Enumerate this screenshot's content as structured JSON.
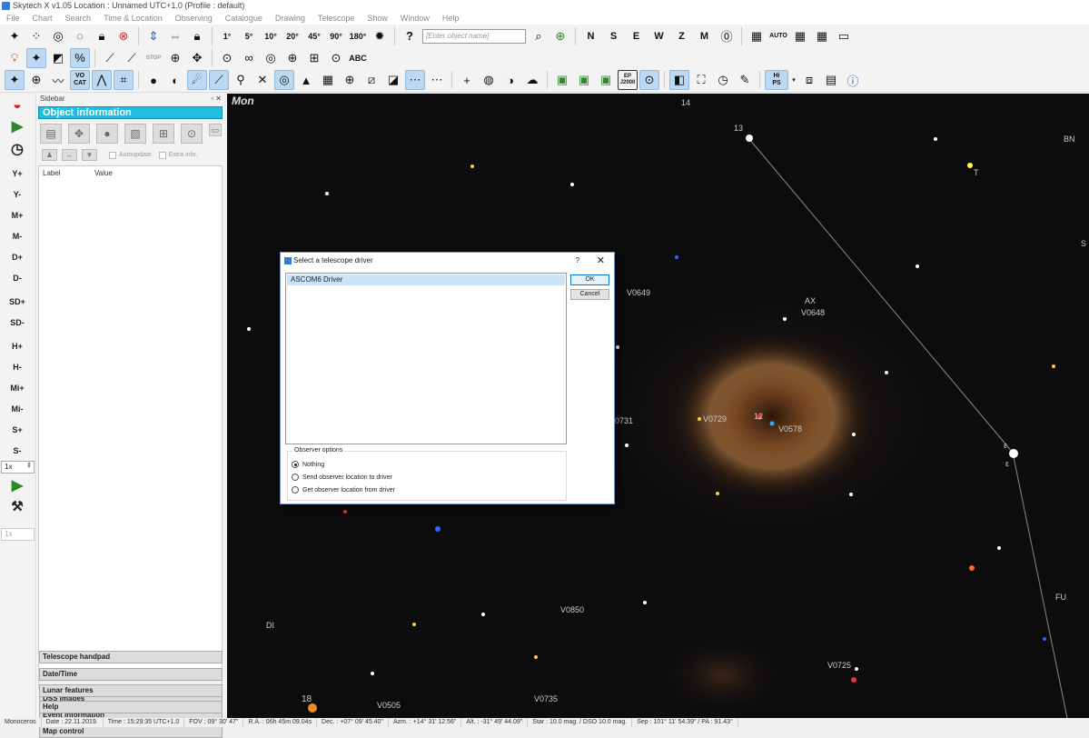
{
  "window": {
    "title": "Skytech X v1.05  Location : Unnamed  UTC+1.0 (Profile : default)"
  },
  "menu": [
    "File",
    "Chart",
    "Search",
    "Time & Location",
    "Observing",
    "Catalogue",
    "Drawing",
    "Telescope",
    "Show",
    "Window",
    "Help"
  ],
  "toolbar1": {
    "fov_labels": [
      "1°",
      "5°",
      "10°",
      "20°",
      "45°",
      "90°",
      "180°"
    ],
    "search_placeholder": "[Enter object name]",
    "help_label": "?",
    "directions": [
      "N",
      "S",
      "E",
      "W",
      "Z",
      "M"
    ],
    "auto_label": "AUTO"
  },
  "toolbar2": {
    "stop_label": "STOP",
    "abc_label": "ABC"
  },
  "toolbar3": {
    "vo_cat_label": "VO\nCAT",
    "hips_label": "Hi\nPS",
    "ep_label": "EP\nJ2000"
  },
  "leftbar": {
    "buttons": [
      "Y+",
      "Y-",
      "M+",
      "M-",
      "D+",
      "D-",
      "SD+",
      "SD-",
      "H+",
      "H-",
      "Mi+",
      "Mi-",
      "S+",
      "S-"
    ],
    "speed_value": "1x",
    "speed_value2": "1x"
  },
  "sidebar": {
    "title": "Sidebar",
    "panel_title": "Object information",
    "autoupdate_label": "Autoupdate",
    "extrainfo_label": "Extra info.",
    "columns": [
      "Label",
      "Value"
    ],
    "panels": [
      "DSS Images",
      "Event information",
      "Map control",
      "Telescope handpad",
      "Date/Time",
      "Lunar features",
      "Help"
    ]
  },
  "sky": {
    "constellation": "Mon",
    "labels": [
      {
        "text": "14"
      },
      {
        "text": "13"
      },
      {
        "text": "BN"
      },
      {
        "text": "T"
      },
      {
        "text": "S"
      },
      {
        "text": "V0649"
      },
      {
        "text": "AX"
      },
      {
        "text": "V0648"
      },
      {
        "text": "V0729"
      },
      {
        "text": "12"
      },
      {
        "text": "V0578"
      },
      {
        "text": "0731"
      },
      {
        "text": "ε"
      },
      {
        "text": "ε"
      },
      {
        "text": "FU"
      },
      {
        "text": "V0850"
      },
      {
        "text": "DI"
      },
      {
        "text": "V0725"
      },
      {
        "text": "18"
      },
      {
        "text": "V0505"
      },
      {
        "text": "V0735"
      }
    ]
  },
  "dialog": {
    "title": "Select a telescope driver",
    "help": "?",
    "close": "✕",
    "driver_item": "ASCOM6 Driver",
    "ok_label": "OK",
    "cancel_label": "Cancel",
    "observer_legend": "Observer options",
    "options": [
      "Nothing",
      "Send observer location to driver",
      "Get observer location from driver"
    ],
    "selected_option": "Nothing"
  },
  "status": {
    "constellation": "Monoceros",
    "date": "Date : 22.11.2019.",
    "time": "Time : 15:29:35 UTC+1.0",
    "fov": "FOV : 09° 30' 47\"",
    "ra": "R.A. : 06h 45m 09.04s",
    "dec": "Dec. : +07° 09' 45.40\"",
    "azm": "Azm. : +14° 31' 12.56\"",
    "alt": "Alt. : -31° 49' 44.09\"",
    "mag": "Star : 10.0 mag. / DSO 10.0 mag.",
    "sep": "Sep : 101° 11' 54.39\" / PA : 91.43°"
  },
  "colors": {
    "accent": "#22bde0",
    "sky_bg": "#0c0c0e",
    "nebula": "#c8894a"
  }
}
